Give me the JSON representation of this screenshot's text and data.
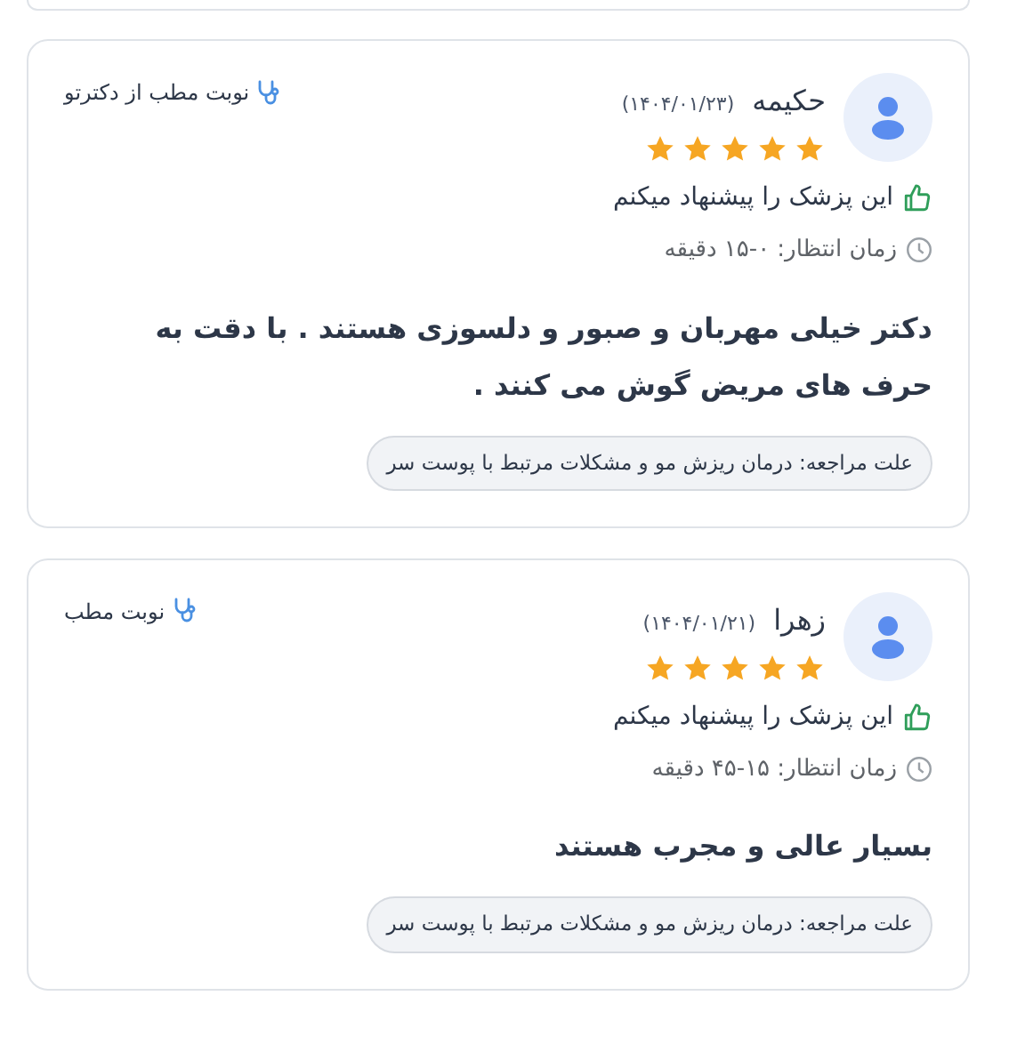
{
  "reviews": [
    {
      "name": "حکیمه",
      "date": "(۱۴۰۴/۰۱/۲۳)",
      "stars": 5,
      "booking": "نوبت مطب از دکترتو",
      "recommendation": "این پزشک را پیشنهاد میکنم",
      "wait_time": "زمان انتظار: ۰-۱۵ دقیقه",
      "comment": "دکتر خیلی مهربان و صبور و دلسوزی هستند . با دقت به حرف های مریض گوش می کنند .",
      "reason": "علت مراجعه: درمان ریزش مو و مشکلات مرتبط با پوست سر"
    },
    {
      "name": "زهرا",
      "date": "(۱۴۰۴/۰۱/۲۱)",
      "stars": 5,
      "booking": "نوبت مطب",
      "recommendation": "این پزشک را پیشنهاد میکنم",
      "wait_time": "زمان انتظار: ۱۵-۴۵ دقیقه",
      "comment": "بسیار عالی و مجرب هستند",
      "reason": "علت مراجعه: درمان ریزش مو و مشکلات مرتبط با پوست سر"
    }
  ]
}
